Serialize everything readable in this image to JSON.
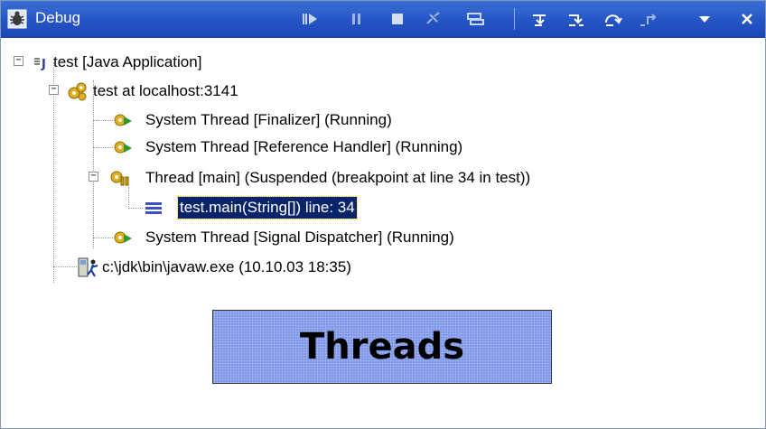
{
  "window": {
    "title": "Debug",
    "toolbar": {
      "resume": "resume-icon",
      "suspend": "suspend-icon",
      "terminate": "terminate-icon",
      "disconnect": "disconnect-icon",
      "remove_terminated": "remove-terminated-icon",
      "step_into": "step-into-icon",
      "step_over": "step-over-icon",
      "step_return": "step-return-icon",
      "drop_to_frame": "drop-to-frame-icon",
      "view_menu": "view-menu-icon",
      "close": "close-icon"
    }
  },
  "tree": {
    "launch": "test [Java Application]",
    "target": "test at localhost:3141",
    "threads": [
      "System Thread [Finalizer] (Running)",
      "System Thread [Reference Handler] (Running)",
      "Thread [main] (Suspended (breakpoint at line 34 in test))",
      "System Thread [Signal Dispatcher] (Running)"
    ],
    "stack_frame": "test.main(String[]) line: 34",
    "process": "c:\\jdk\\bin\\javaw.exe (10.10.03 18:35)"
  },
  "callout": {
    "label": "Threads"
  },
  "colors": {
    "titlebar": "#2453c3",
    "selection": "#0a246a",
    "callout": "#7d96e8"
  }
}
